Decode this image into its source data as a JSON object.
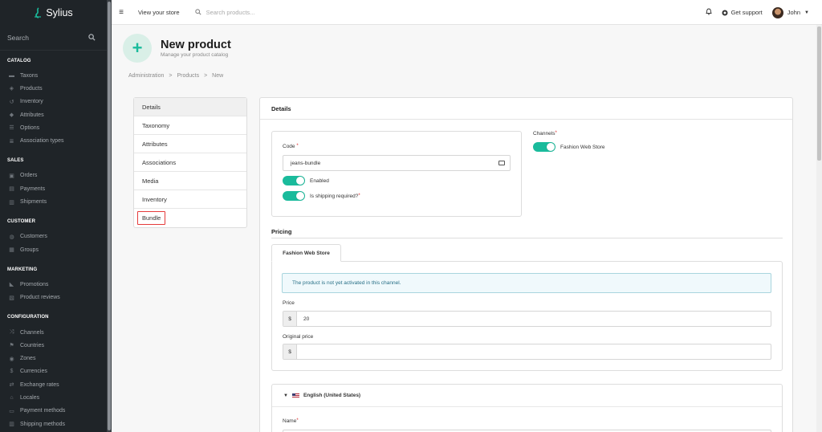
{
  "app": {
    "name": "Sylius"
  },
  "sidebar": {
    "search_label": "Search",
    "sections": [
      {
        "header": "CATALOG",
        "items": [
          {
            "label": "Taxons",
            "icon": "folder-icon"
          },
          {
            "label": "Products",
            "icon": "cube-icon"
          },
          {
            "label": "Inventory",
            "icon": "history-icon"
          },
          {
            "label": "Attributes",
            "icon": "cubes-icon"
          },
          {
            "label": "Options",
            "icon": "options-icon"
          },
          {
            "label": "Association types",
            "icon": "tasks-icon"
          }
        ]
      },
      {
        "header": "SALES",
        "items": [
          {
            "label": "Orders",
            "icon": "cart-icon"
          },
          {
            "label": "Payments",
            "icon": "payment-icon"
          },
          {
            "label": "Shipments",
            "icon": "truck-icon"
          }
        ]
      },
      {
        "header": "CUSTOMER",
        "items": [
          {
            "label": "Customers",
            "icon": "users-icon"
          },
          {
            "label": "Groups",
            "icon": "archive-icon"
          }
        ]
      },
      {
        "header": "MARKETING",
        "items": [
          {
            "label": "Promotions",
            "icon": "megaphone-icon"
          },
          {
            "label": "Product reviews",
            "icon": "newspaper-icon"
          }
        ]
      },
      {
        "header": "CONFIGURATION",
        "items": [
          {
            "label": "Channels",
            "icon": "shuffle-icon"
          },
          {
            "label": "Countries",
            "icon": "flag-icon"
          },
          {
            "label": "Zones",
            "icon": "globe-icon"
          },
          {
            "label": "Currencies",
            "icon": "dollar-icon"
          },
          {
            "label": "Exchange rates",
            "icon": "exchange-icon"
          },
          {
            "label": "Locales",
            "icon": "translate-icon"
          },
          {
            "label": "Payment methods",
            "icon": "card-icon"
          },
          {
            "label": "Shipping methods",
            "icon": "shipping-icon"
          }
        ]
      }
    ]
  },
  "topbar": {
    "view_store": "View your store",
    "search_placeholder": "Search products...",
    "support": "Get support",
    "user": "John"
  },
  "page": {
    "title": "New product",
    "subtitle": "Manage your product catalog",
    "breadcrumb": [
      "Administration",
      "Products",
      "New"
    ]
  },
  "tabs": [
    "Details",
    "Taxonomy",
    "Attributes",
    "Associations",
    "Media",
    "Inventory",
    "Bundle"
  ],
  "details": {
    "heading": "Details",
    "code_label": "Code",
    "code_value": "jeans-bundle",
    "enabled_label": "Enabled",
    "shipping_label": "Is shipping required?",
    "channels_label": "Channels",
    "channel_name": "Fashion Web Store"
  },
  "pricing": {
    "title": "Pricing",
    "tab": "Fashion Web Store",
    "message": "The product is not yet activated in this channel.",
    "price_label": "Price",
    "currency": "$",
    "price_value": "20",
    "original_price_label": "Original price"
  },
  "translation": {
    "locale": "English (United States)",
    "name_label": "Name"
  },
  "colors": {
    "accent": "#1abb9c",
    "sidebar": "#1f2428"
  }
}
